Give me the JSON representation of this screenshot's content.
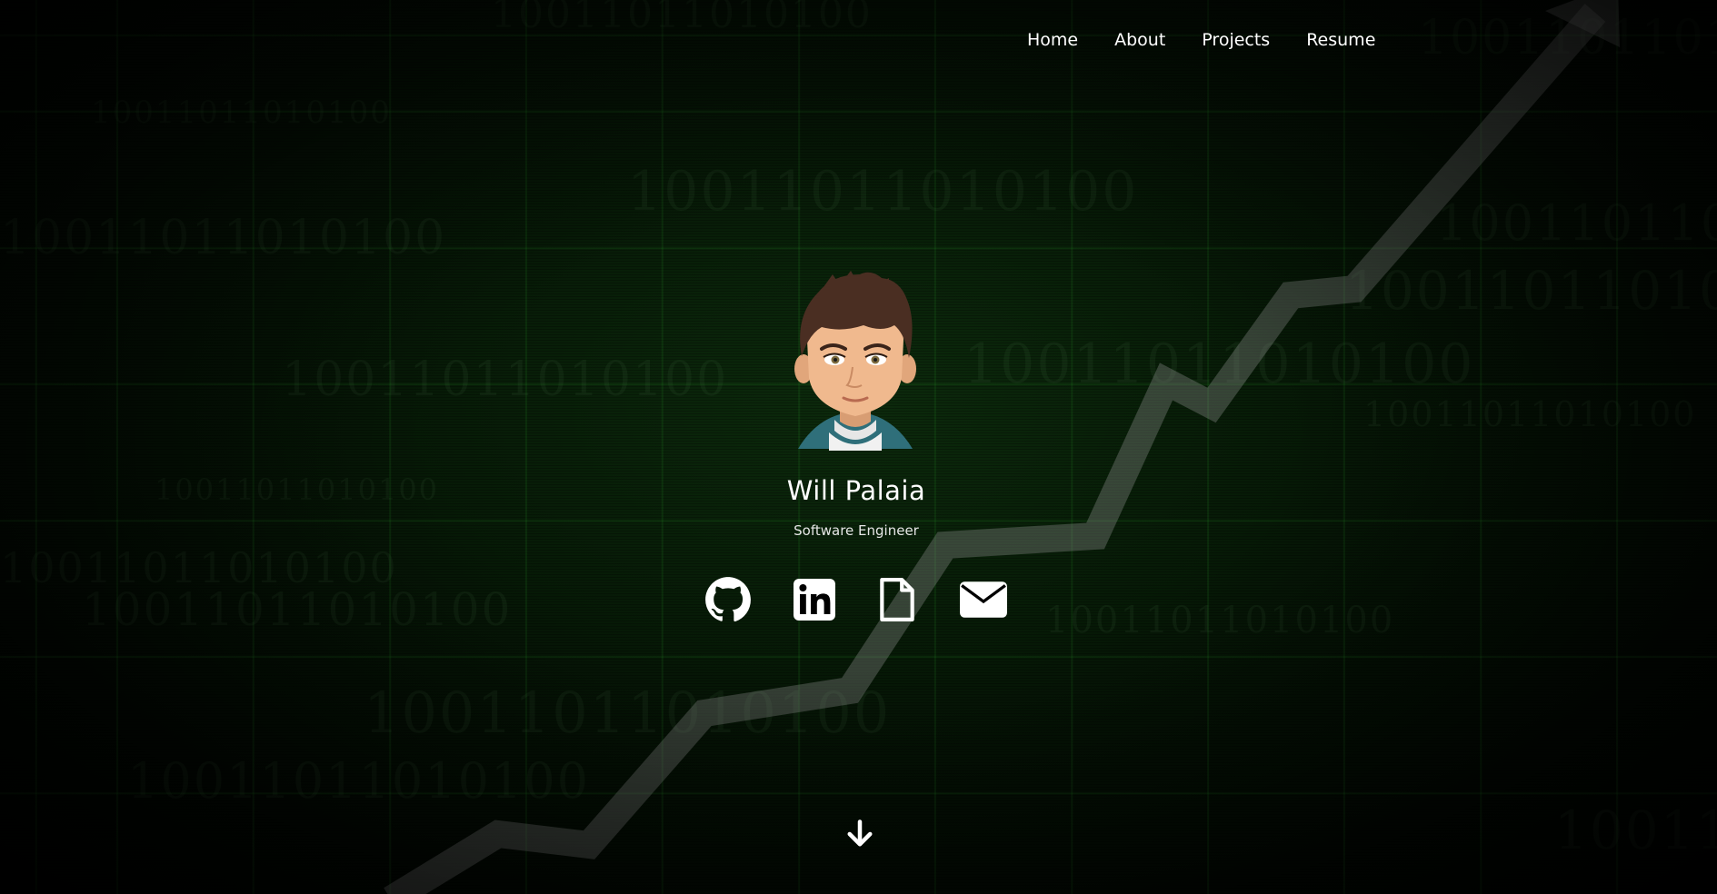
{
  "nav": {
    "items": [
      {
        "label": "Home"
      },
      {
        "label": "About"
      },
      {
        "label": "Projects"
      },
      {
        "label": "Resume"
      }
    ]
  },
  "profile": {
    "name": "Will Palaia",
    "title": "Software Engineer",
    "avatar_icon": "cartoon-avatar"
  },
  "social": [
    {
      "icon": "github-icon"
    },
    {
      "icon": "linkedin-icon"
    },
    {
      "icon": "document-icon"
    },
    {
      "icon": "envelope-icon"
    }
  ],
  "scroll": {
    "icon": "arrow-down-icon"
  },
  "background": {
    "digits": "10011011010100",
    "accent": "#1e7a1e"
  }
}
